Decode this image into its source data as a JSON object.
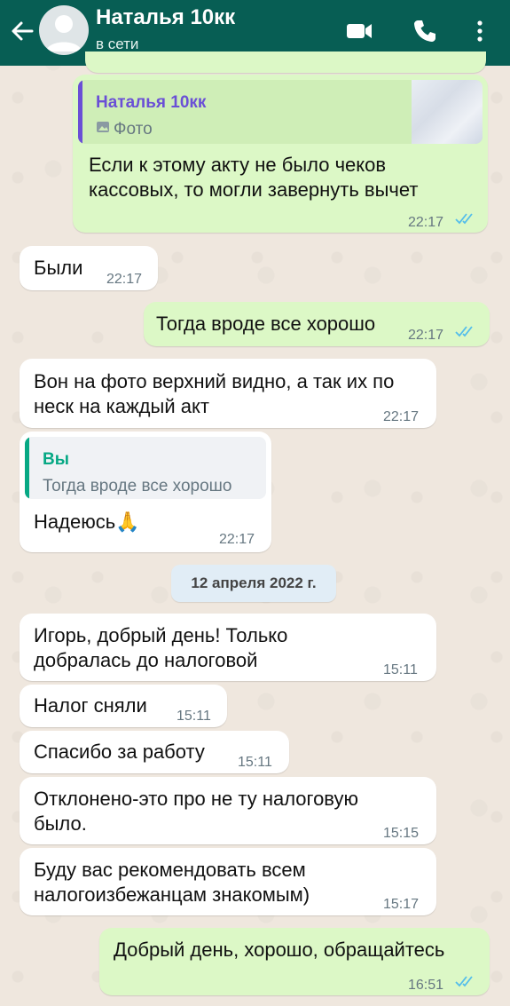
{
  "header": {
    "contact_name": "Наталья 10кк",
    "status": "в сети",
    "icons": [
      "back-arrow-icon",
      "avatar",
      "video-call-icon",
      "phone-icon",
      "more-menu-icon"
    ],
    "color": "#075e54"
  },
  "messages": [
    {
      "direction": "out",
      "reply_to": {
        "author": "Наталья 10кк",
        "text": "Фото",
        "type": "photo"
      },
      "lines": [
        "Если к этому акту не было чеков",
        "кассовых, то могли завернуть вычет"
      ],
      "time": "22:17",
      "read": true
    },
    {
      "direction": "in",
      "lines": [
        "Были"
      ],
      "time": "22:17"
    },
    {
      "direction": "out",
      "lines": [
        "Тогда вроде все хорошо"
      ],
      "time": "22:17",
      "read": true
    },
    {
      "direction": "in",
      "lines": [
        "Вон на фото верхний видно, а так их по",
        "неск на каждый акт"
      ],
      "time": "22:17"
    },
    {
      "direction": "in",
      "reply_to": {
        "author": "Вы",
        "text": "Тогда вроде все хорошо"
      },
      "lines": [
        "Надеюсь🙏"
      ],
      "time": "22:17"
    },
    {
      "direction": "date",
      "label": "12 апреля 2022 г."
    },
    {
      "direction": "in",
      "lines": [
        "Игорь, добрый день! Только",
        "добралась до налоговой"
      ],
      "time": "15:11"
    },
    {
      "direction": "in",
      "lines": [
        "Налог сняли"
      ],
      "time": "15:11"
    },
    {
      "direction": "in",
      "lines": [
        "Спасибо за работу"
      ],
      "time": "15:11"
    },
    {
      "direction": "in",
      "lines": [
        "Отклонено-это про не ту налоговую",
        "было."
      ],
      "time": "15:15"
    },
    {
      "direction": "in",
      "lines": [
        "Буду вас рекомендовать всем",
        "налогоизбежанцам знакомым)"
      ],
      "time": "15:17"
    },
    {
      "direction": "out",
      "lines": [
        "Добрый день, хорошо, обращайтесь"
      ],
      "time": "16:51",
      "read": true
    }
  ],
  "colors": {
    "incoming_bubble": "#ffffff",
    "outgoing_bubble": "#dcf8c6",
    "read_ticks": "#53bdeb",
    "quote_self": "#06a884",
    "quote_other": "#6a4fd6"
  }
}
